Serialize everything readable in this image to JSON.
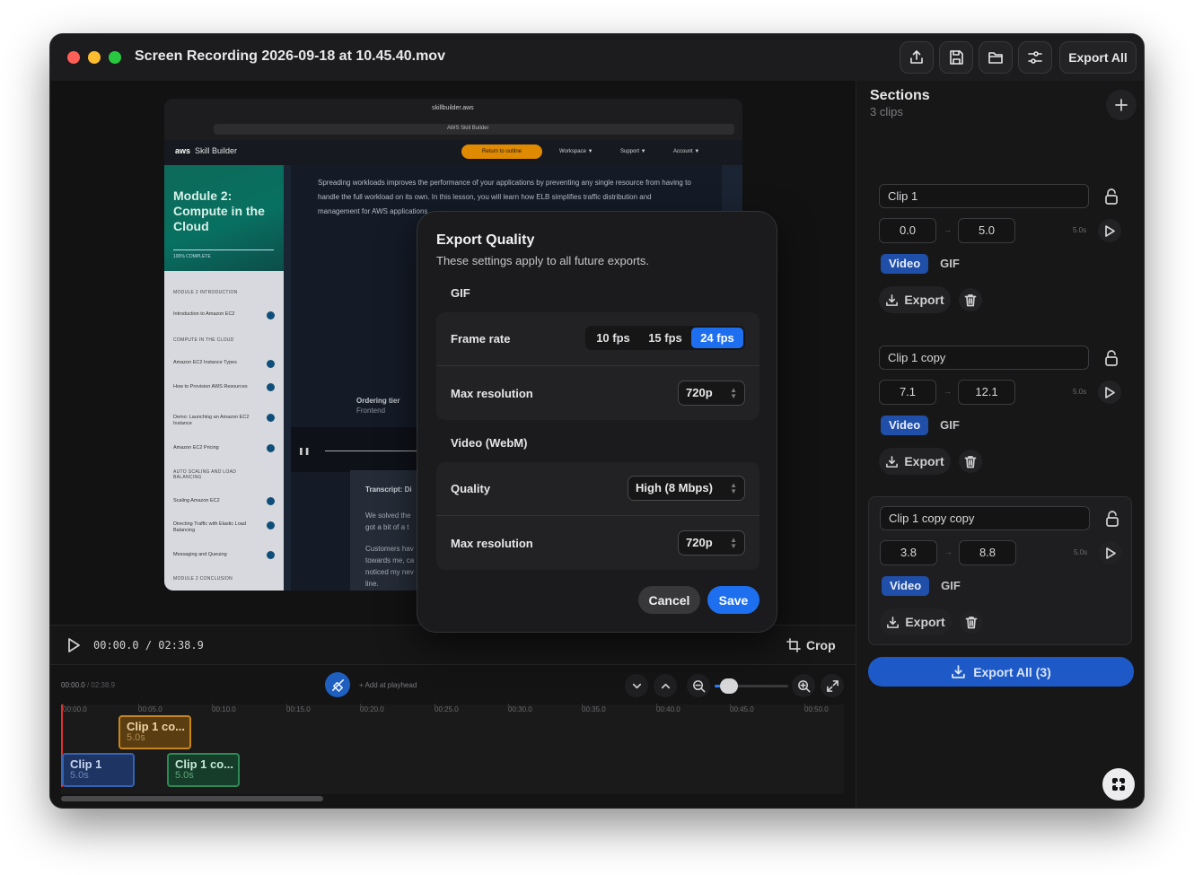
{
  "window": {
    "title": "Screen Recording 2026-09-18 at 10.45.40.mov",
    "export_all_label": "Export All"
  },
  "toolbar_icons": [
    "share-icon",
    "save-icon",
    "folder-icon",
    "sliders-icon"
  ],
  "video": {
    "url": "skillbuilder.aws",
    "tab_title": "AWS Skill Builder",
    "brand": "Skill Builder",
    "return_pill": "Return to outline",
    "menu": [
      "Workspace ▼",
      "Support ▼",
      "Account ▼"
    ],
    "module_title": "Module 2: Compute in the Cloud",
    "progress": "100% COMPLETE",
    "sections": [
      "MODULE 2 INTRODUCTION",
      "COMPUTE IN THE CLOUD",
      "AUTO SCALING AND LOAD BALANCING",
      "MODULE 2 CONCLUSION"
    ],
    "lessons": [
      "Introduction to Amazon EC2",
      "Amazon EC2 Instance Types",
      "How to Provision AWS Resources",
      "Demo: Launching an Amazon EC2 Instance",
      "Amazon EC2 Pricing",
      "Scaling Amazon EC2",
      "Directing Traffic with Elastic Load Balancing",
      "Messaging and Queuing"
    ],
    "body_text": "Spreading workloads improves the performance of your applications by preventing any single resource from having to handle the full workload on its own. In this lesson, you will learn how ELB simplifies traffic distribution and management for AWS applications.",
    "ordering_tier": "Ordering tier",
    "frontend": "Frontend",
    "transcript_title": "Transcript: Di",
    "transcript_lines": [
      "We solved the",
      "got a bit of a t",
      "Customers hav",
      "towards me, ca",
      "noticed my nev",
      "line."
    ]
  },
  "transport": {
    "current": "00:00.0",
    "separator": "/",
    "total": "02:38.9",
    "crop_label": "Crop"
  },
  "timeline": {
    "head_current": "00:00.0",
    "head_total": "/ 02:38.9",
    "add_label": "+ Add at playhead",
    "zoom_level": 0.2,
    "ticks": [
      "00:00.0",
      "00:05.0",
      "00:10.0",
      "00:15.0",
      "00:20.0",
      "00:25.0",
      "00:30.0",
      "00:35.0",
      "00:40.0",
      "00:45.0",
      "00:50.0"
    ],
    "clips": [
      {
        "name": "Clip 1 co...",
        "duration": "5.0s",
        "color": "#c9861a"
      },
      {
        "name": "Clip 1",
        "duration": "5.0s",
        "color": "#3563b5"
      },
      {
        "name": "Clip 1 co...",
        "duration": "5.0s",
        "color": "#2e8a55"
      }
    ]
  },
  "panel": {
    "title": "Sections",
    "subtitle": "3 clips",
    "clips": [
      {
        "name": "Clip 1",
        "start": "0.0",
        "end": "5.0",
        "duration": "5.0s",
        "format_video": "Video",
        "format_gif": "GIF",
        "export_label": "Export"
      },
      {
        "name": "Clip 1 copy",
        "start": "7.1",
        "end": "12.1",
        "duration": "5.0s",
        "format_video": "Video",
        "format_gif": "GIF",
        "export_label": "Export"
      },
      {
        "name": "Clip 1 copy copy",
        "start": "3.8",
        "end": "8.8",
        "duration": "5.0s",
        "format_video": "Video",
        "format_gif": "GIF",
        "export_label": "Export"
      }
    ],
    "export_all_label": "Export All (3)"
  },
  "modal": {
    "title": "Export Quality",
    "subtitle": "These settings apply to all future exports.",
    "gif_section": "GIF",
    "frame_rate_label": "Frame rate",
    "fps_options": [
      "10 fps",
      "15 fps",
      "24 fps"
    ],
    "fps_selected": "24 fps",
    "gif_res_label": "Max resolution",
    "gif_res_value": "720p",
    "video_section": "Video (WebM)",
    "quality_label": "Quality",
    "quality_value": "High (8 Mbps)",
    "video_res_label": "Max resolution",
    "video_res_value": "720p",
    "cancel_label": "Cancel",
    "save_label": "Save"
  },
  "colors": {
    "accent": "#1e6ff0",
    "export_all": "#1d5ac8",
    "playhead": "#e0312e"
  }
}
